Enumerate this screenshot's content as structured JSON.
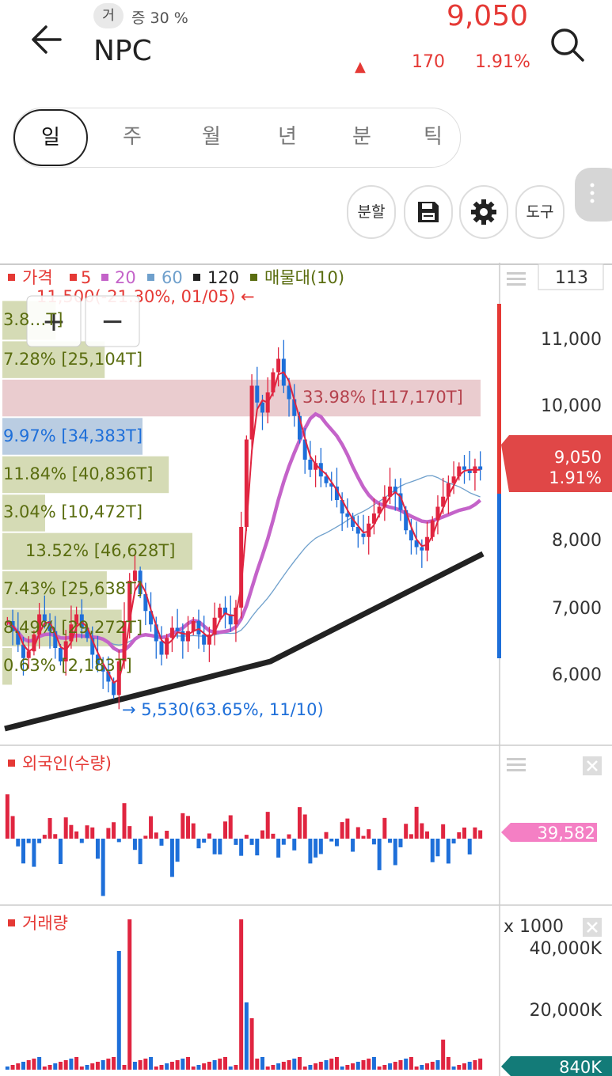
{
  "header": {
    "back_icon": "arrow-left-icon",
    "badge": "거",
    "margin_text": "증 30 %",
    "stock_name": "NPC",
    "price": "9,050",
    "change_arrow": "▲",
    "change": "170",
    "change_rate": "1.91%",
    "search_icon": "search-icon",
    "colors": {
      "up": "#e53935",
      "down": "#1e6fd9"
    }
  },
  "period_tabs": [
    "일",
    "주",
    "월",
    "년",
    "분",
    "틱"
  ],
  "toolbar": {
    "split": "분할",
    "save_icon": "save-icon",
    "settings_icon": "gear-icon",
    "tools": "도구"
  },
  "chart": {
    "zoom_in": "+",
    "zoom_out": "−",
    "legend": {
      "price": "가격",
      "ma5": "5",
      "ma20": "20",
      "ma60": "60",
      "ma120": "120",
      "volume_profile": "매물대(10)"
    },
    "top_count": "113",
    "high_note": "11,500(-21.30%, 01/05) ←",
    "low_note": "→ 5,530(63.65%, 11/10)",
    "price_label": "9,050",
    "price_label_rate": "1.91%",
    "profile_labels": [
      "3.8…T]",
      "7.28% [25,104T]",
      "33.98% [117,170T]",
      "9.97% [34,383T]",
      "11.84% [40,836T]",
      "3.04% [10,472T]",
      "13.52% [46,628T]",
      "7.43% [25,638T]",
      "8.49% [29,272T]",
      "0.63% [2,183T]"
    ],
    "foreign_title": "외국인(수량)",
    "foreign_value": "39,582",
    "volume_title": "거래량",
    "volume_unit": "x 1000",
    "volume_value": "840K",
    "close_icon": "close-icon",
    "menu_icon": "menu-lines-icon"
  },
  "chart_data": {
    "type": "candlestick",
    "price_axis_ticks": [
      6000,
      7000,
      8000,
      9000,
      10000,
      11000
    ],
    "price_axis_labels": [
      "6,000",
      "7,000",
      "8,000",
      "10,000",
      "11,000"
    ],
    "price_range": [
      5000,
      11600
    ],
    "current_price": 9050,
    "high": 11500,
    "low": 5530,
    "closes": [
      6800,
      6650,
      6450,
      6250,
      6350,
      6600,
      6900,
      6800,
      6650,
      6400,
      6200,
      6500,
      6750,
      6900,
      6700,
      6550,
      6300,
      6150,
      6050,
      5900,
      5700,
      6200,
      6800,
      7400,
      7550,
      7200,
      6950,
      6750,
      6500,
      6300,
      6550,
      6700,
      6650,
      6500,
      6650,
      6800,
      6600,
      6450,
      6600,
      6850,
      7000,
      6900,
      6750,
      7000,
      8200,
      9500,
      10300,
      10050,
      9900,
      10200,
      10500,
      10700,
      10300,
      10100,
      9850,
      9500,
      9200,
      9050,
      9150,
      8950,
      8850,
      8800,
      8600,
      8400,
      8350,
      8200,
      8100,
      8050,
      8250,
      8400,
      8500,
      8650,
      8800,
      8700,
      8450,
      8150,
      8000,
      7900,
      7850,
      8050,
      8300,
      8500,
      8650,
      8850,
      8950,
      9100,
      9050,
      9000,
      9100,
      9050
    ],
    "ma120": [
      5200,
      5250,
      5300,
      5350,
      5400,
      5450,
      5500,
      5550,
      5600,
      5650,
      5700,
      5750,
      5800,
      5850,
      5900,
      5950,
      6000,
      6050,
      6100,
      6150,
      6200,
      6300,
      6400,
      6500,
      6600,
      6700,
      6800,
      6900,
      7000,
      7100,
      7200,
      7300,
      7400,
      7500,
      7600,
      7700,
      7800
    ],
    "volume_profile": [
      {
        "range": [
          10960,
          11560
        ],
        "pct": 3.8
      },
      {
        "range": [
          10390,
          10960
        ],
        "pct": 7.28
      },
      {
        "range": [
          9820,
          10390
        ],
        "pct": 33.98
      },
      {
        "range": [
          9250,
          9820
        ],
        "pct": 9.97
      },
      {
        "range": [
          8680,
          9250
        ],
        "pct": 11.84
      },
      {
        "range": [
          8110,
          8680
        ],
        "pct": 3.04
      },
      {
        "range": [
          7540,
          8110
        ],
        "pct": 13.52
      },
      {
        "range": [
          6970,
          7540
        ],
        "pct": 7.43
      },
      {
        "range": [
          6400,
          6970
        ],
        "pct": 8.49
      },
      {
        "range": [
          5830,
          6400
        ],
        "pct": 0.63
      }
    ],
    "volume_axis": [
      "20,000K",
      "40,000K"
    ]
  }
}
